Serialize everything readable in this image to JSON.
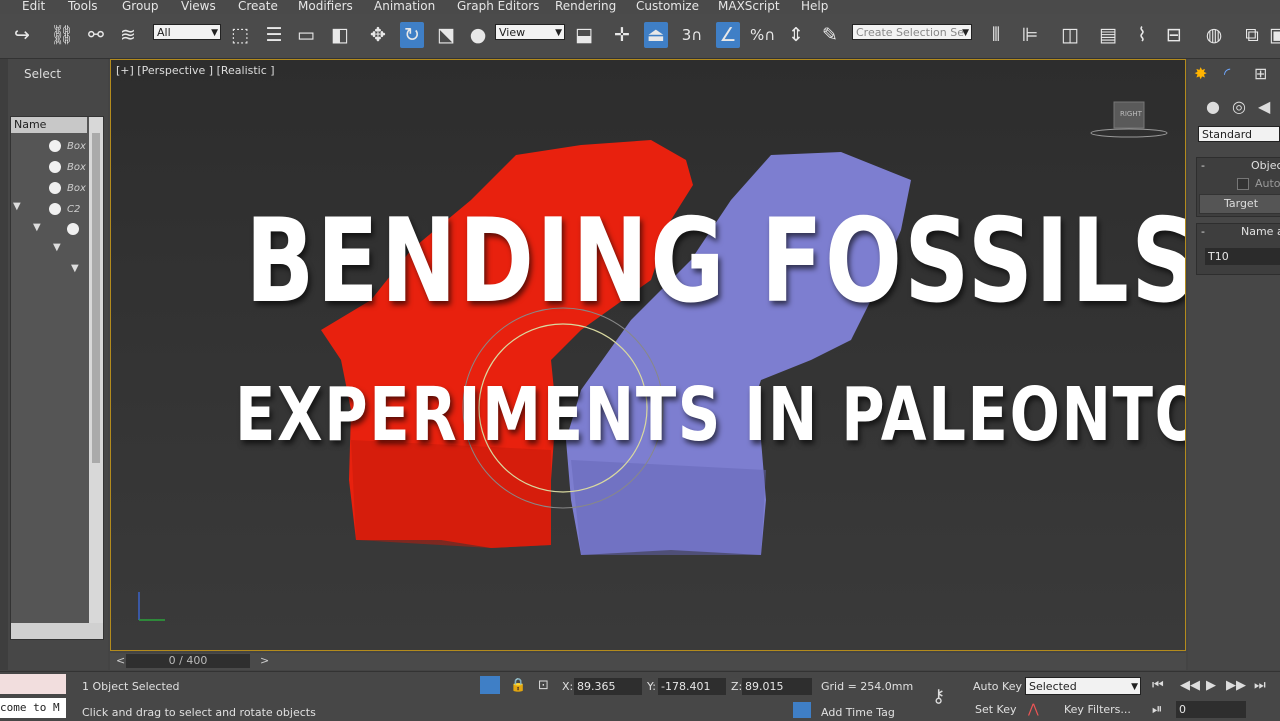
{
  "menu": [
    "Edit",
    "Tools",
    "Group",
    "Views",
    "Create",
    "Modifiers",
    "Animation",
    "Graph Editors",
    "Rendering",
    "Customize",
    "MAXScript",
    "Help"
  ],
  "toolbar": {
    "filter_value": "All",
    "refcoord_value": "View",
    "selection_set_placeholder": "Create Selection Se",
    "snap_label": "3"
  },
  "left_panel": {
    "select_label": "Select",
    "column_header": "Name",
    "items": [
      "Box",
      "Box",
      "Box",
      "C2"
    ]
  },
  "viewport": {
    "label": "[+] [Perspective ] [Realistic ]",
    "title": "BENDING FOSSILS",
    "subtitle": "EXPERIMENTS IN PALEONTOLOGY",
    "viewcube": "RIGHT",
    "colors": {
      "left_fossil": "#e8210e",
      "right_fossil": "#7d7ed0",
      "border": "#b38b1d"
    }
  },
  "right_panel": {
    "type_dropdown": "Standard",
    "rollout_object": "Objec",
    "autogrid": "Auto",
    "target_button": "Target",
    "rollout_name": "Name a",
    "name_value": "T10"
  },
  "time_slider": {
    "frame": "0 / 400"
  },
  "status": {
    "maxscript": "come to M",
    "selected": "1 Object Selected",
    "prompt": "Click and drag to select and rotate objects",
    "x_label": "X:",
    "x_value": "89.365",
    "y_label": "Y:",
    "y_value": "-178.401",
    "z_label": "Z:",
    "z_value": "89.015",
    "grid": "Grid = 254.0mm",
    "add_time_tag": "Add Time Tag",
    "auto_key": "Auto Key",
    "set_key": "Set Key",
    "key_mode": "Selected",
    "key_filters": "Key Filters...",
    "frame_field": "0"
  }
}
